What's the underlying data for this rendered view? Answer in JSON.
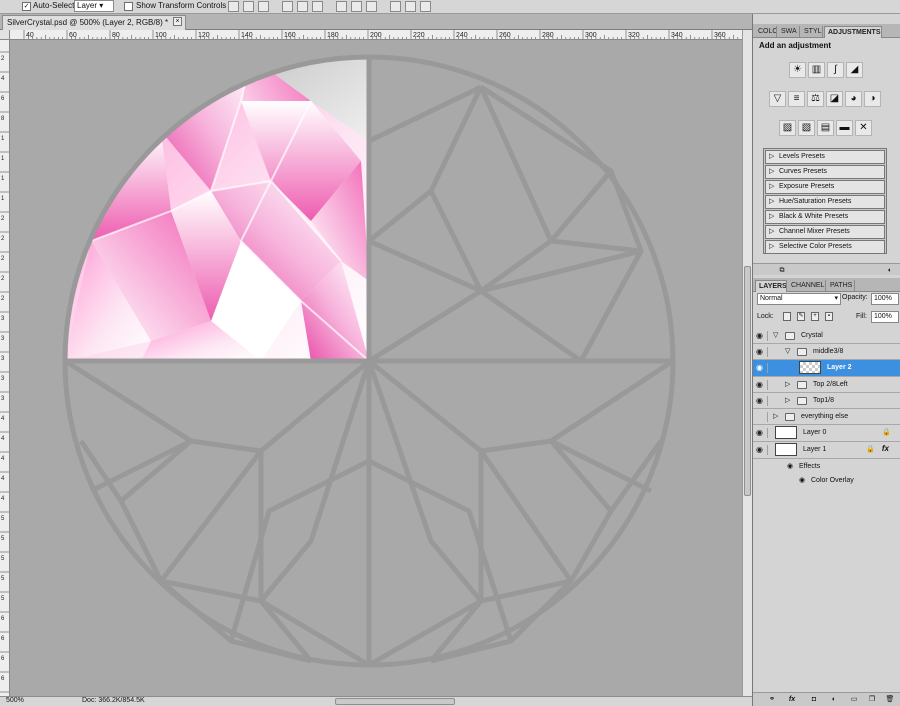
{
  "options_bar": {
    "auto_select_label": "Auto-Select:",
    "auto_select_value": "Layer",
    "show_transform_label": "Show Transform Controls"
  },
  "document": {
    "tab_title": "SilverCrystal.psd @ 500% (Layer 2, RGB/8) *",
    "close_glyph": "×"
  },
  "ruler": {
    "top_ticks": [
      "40",
      "60",
      "80",
      "100",
      "120",
      "140",
      "160",
      "180",
      "200",
      "220",
      "240",
      "260",
      "280",
      "300",
      "320",
      "340",
      "360"
    ],
    "left_ticks": [
      "2",
      "4",
      "6",
      "8",
      "1",
      "1",
      "1",
      "1",
      "2",
      "2",
      "2",
      "2",
      "2",
      "3",
      "3",
      "3",
      "3",
      "3",
      "4",
      "4",
      "4",
      "4",
      "4",
      "5",
      "5",
      "5",
      "5",
      "5",
      "6",
      "6",
      "6",
      "6",
      "6"
    ]
  },
  "status": {
    "zoom": "500%",
    "doc_info": "Doc: 366.2K/854.5K"
  },
  "panels": {
    "top_tabs": [
      "COLO",
      "SWA",
      "STYL",
      "ADJUSTMENTS"
    ],
    "adjustments_title": "Add an adjustment",
    "adj_icons_row1": [
      "brightness-contrast-icon",
      "levels-icon",
      "curves-icon",
      "exposure-icon"
    ],
    "adj_icons_row2": [
      "vibrance-icon",
      "hue-saturation-icon",
      "color-balance-icon",
      "black-white-icon",
      "photo-filter-icon",
      "channel-mixer-icon"
    ],
    "adj_icons_row3": [
      "invert-icon",
      "posterize-icon",
      "threshold-icon",
      "gradient-map-icon",
      "selective-color-icon"
    ],
    "adj_glyphs_row1": [
      "☀",
      "▥",
      "∫",
      "◢"
    ],
    "adj_glyphs_row2": [
      "▽",
      "≡",
      "⚖",
      "◪",
      "◕",
      "◑"
    ],
    "adj_glyphs_row3": [
      "▨",
      "▧",
      "▤",
      "▬",
      "✕"
    ],
    "presets": [
      "Levels Presets",
      "Curves Presets",
      "Exposure Presets",
      "Hue/Saturation Presets",
      "Black & White Presets",
      "Channel Mixer Presets",
      "Selective Color Presets"
    ],
    "layer_tabs": [
      "LAYERS",
      "CHANNELS",
      "PATHS"
    ]
  },
  "layers_panel": {
    "blend_mode": "Normal",
    "opacity_label": "Opacity:",
    "opacity_value": "100%",
    "lock_label": "Lock:",
    "fill_label": "Fill:",
    "fill_value": "100%",
    "rows": [
      {
        "name": "Crystal",
        "kind": "group",
        "depth": 0,
        "expanded": true,
        "visible": true
      },
      {
        "name": "middle3/8",
        "kind": "group",
        "depth": 1,
        "expanded": true,
        "visible": true
      },
      {
        "name": "Layer 2",
        "kind": "layer",
        "depth": 2,
        "selected": true,
        "visible": true
      },
      {
        "name": "Top 2/8Left",
        "kind": "group",
        "depth": 1,
        "expanded": false,
        "visible": true
      },
      {
        "name": "Top1/8",
        "kind": "group",
        "depth": 1,
        "expanded": false,
        "visible": true
      },
      {
        "name": "everything else",
        "kind": "group",
        "depth": 0,
        "expanded": false,
        "visible": false
      },
      {
        "name": "Layer 0",
        "kind": "layer",
        "depth": 0,
        "locked": true,
        "visible": true
      },
      {
        "name": "Layer 1",
        "kind": "layer",
        "depth": 0,
        "locked": true,
        "has_fx": true,
        "visible": true
      }
    ],
    "effects_label": "Effects",
    "color_overlay_label": "Color Overlay",
    "fx_glyph": "fx"
  },
  "colors": {
    "selection": "#3d8fe0",
    "pink": "#f06ab5",
    "crystal_lines": "#999999",
    "canvas_bg": "#a9a9a9"
  }
}
